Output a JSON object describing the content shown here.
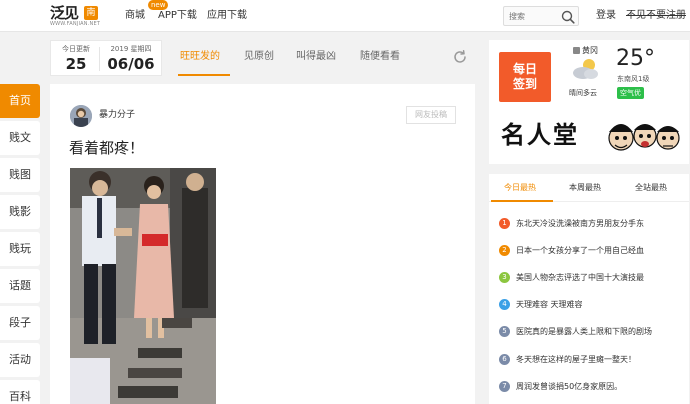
{
  "header": {
    "logo_text": "泛见",
    "logo_badge": "南",
    "logo_sub": "WWW.FANJIAN.NET",
    "nav": [
      {
        "label": "商城",
        "badge": "new"
      },
      {
        "label": "APP下载"
      },
      {
        "label": "应用下载"
      }
    ],
    "search_placeholder": "搜索",
    "login_label": "登录",
    "register_label": "不见不要注册"
  },
  "sidebar": {
    "items": [
      {
        "label": "首页",
        "active": true
      },
      {
        "label": "贱文"
      },
      {
        "label": "贱图"
      },
      {
        "label": "贱影"
      },
      {
        "label": "贱玩"
      },
      {
        "label": "话题"
      },
      {
        "label": "段子"
      },
      {
        "label": "活动"
      },
      {
        "label": "百科"
      }
    ]
  },
  "date_card": {
    "update_label": "今日更新",
    "update_count": "25",
    "date_line": "2019 星期四",
    "date": "06/06"
  },
  "tabs": [
    {
      "label": "旺旺发的",
      "active": true
    },
    {
      "label": "见原创"
    },
    {
      "label": "叫得最凶"
    },
    {
      "label": "随便看看"
    }
  ],
  "post": {
    "author": "暴力分子",
    "submit_label": "网友投稿",
    "title": "看着都疼！"
  },
  "weather": {
    "checkin_line1": "每日",
    "checkin_line2": "签到",
    "wind_dir": "黄冈",
    "description": "晴间多云",
    "temperature": "25°",
    "wind_level": "东南风1级",
    "air_quality": "空气优",
    "fame_label": "名人堂"
  },
  "hot": {
    "tabs": [
      {
        "label": "今日最热",
        "active": true
      },
      {
        "label": "本周最热"
      },
      {
        "label": "全站最热"
      }
    ],
    "items": [
      {
        "num": "1",
        "color": "#f25b2a",
        "text": "东北天冷没洗澡被南方男朋友分手东"
      },
      {
        "num": "2",
        "color": "#f08a00",
        "text": "日本一个女孩分享了一个用自己经血"
      },
      {
        "num": "3",
        "color": "#8cc63f",
        "text": "美国人物杂志评选了中国十大演技最"
      },
      {
        "num": "4",
        "color": "#3ba0e6",
        "text": "天理难容 天理难容"
      },
      {
        "num": "5",
        "color": "#7b8ba8",
        "text": "医院真的是暴露人类上限和下限的剧场"
      },
      {
        "num": "6",
        "color": "#7b8ba8",
        "text": "冬天想在这样的屋子里瘫一整天！"
      },
      {
        "num": "7",
        "color": "#7b8ba8",
        "text": "周润发曾谈捐50亿身家原因。"
      }
    ]
  }
}
